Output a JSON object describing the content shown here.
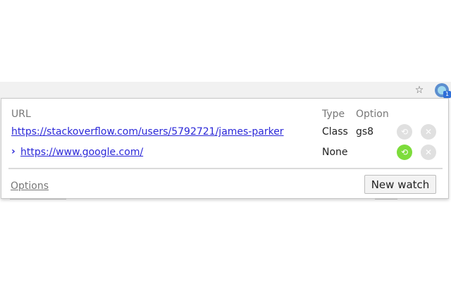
{
  "toolbar": {
    "star_icon": "star-icon",
    "extension_badge": "1"
  },
  "popup": {
    "headers": {
      "url": "URL",
      "type": "Type",
      "option": "Option"
    },
    "rows": [
      {
        "url": "https://stackoverflow.com/users/5792721/james-parker",
        "type": "Class",
        "option": "gs8",
        "refresh_active": false,
        "expand_icon": null
      },
      {
        "url": "https://www.google.com/",
        "type": "None",
        "option": "",
        "refresh_active": true,
        "expand_icon": "chevron-right-icon"
      }
    ],
    "options_label": "Options",
    "new_watch_label": "New watch"
  },
  "colors": {
    "link": "#2a27d8",
    "active_refresh": "#7ddc3b",
    "inactive_button": "#e0e0e0"
  }
}
